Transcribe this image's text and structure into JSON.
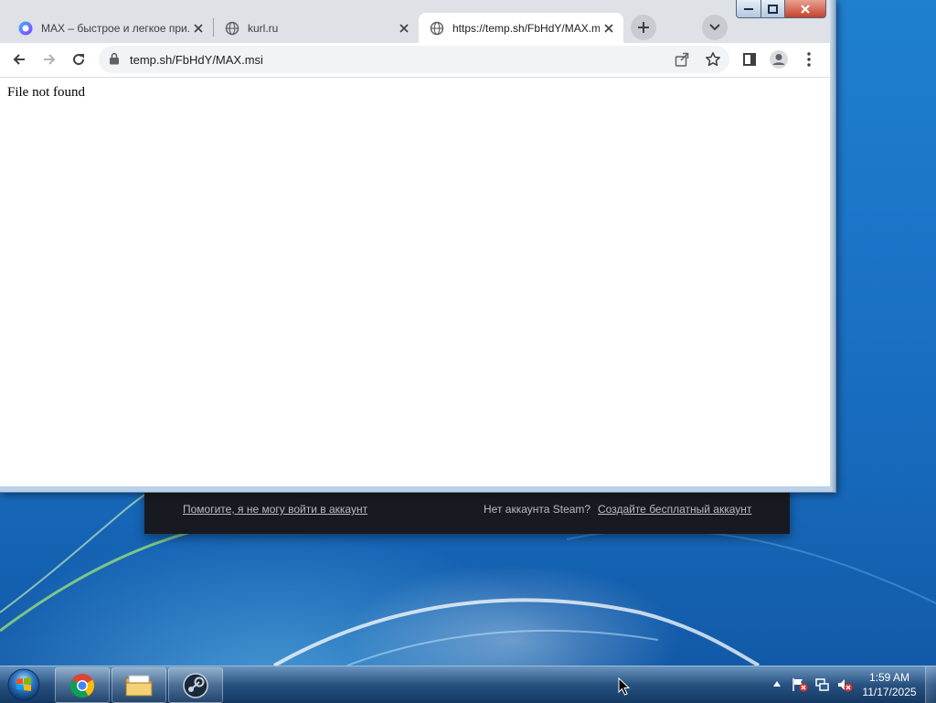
{
  "browser": {
    "tabs": [
      {
        "title": "MAX – быстрое и легкое при...",
        "favicon": "max-logo-icon",
        "active": false
      },
      {
        "title": "kurl.ru",
        "favicon": "globe-icon",
        "active": false
      },
      {
        "title": "https://temp.sh/FbHdY/MAX.msi",
        "favicon": "globe-icon",
        "active": true
      }
    ],
    "address": "temp.sh/FbHdY/MAX.msi",
    "page_text": "File not found"
  },
  "steam_login_footer": {
    "help_link": "Помогите, я не могу войти в аккаунт",
    "no_account": "Нет аккаунта Steam?",
    "create_link": "Создайте бесплатный аккаунт"
  },
  "taskbar": {
    "apps": [
      "chrome-icon",
      "file-explorer-icon",
      "steam-icon"
    ],
    "clock_time": "1:59 AM",
    "clock_date": "11/17/2025"
  },
  "colors": {
    "tabstrip": "#dee1e6",
    "steam_panel": "#181a21",
    "close_button": "#c7412a"
  }
}
